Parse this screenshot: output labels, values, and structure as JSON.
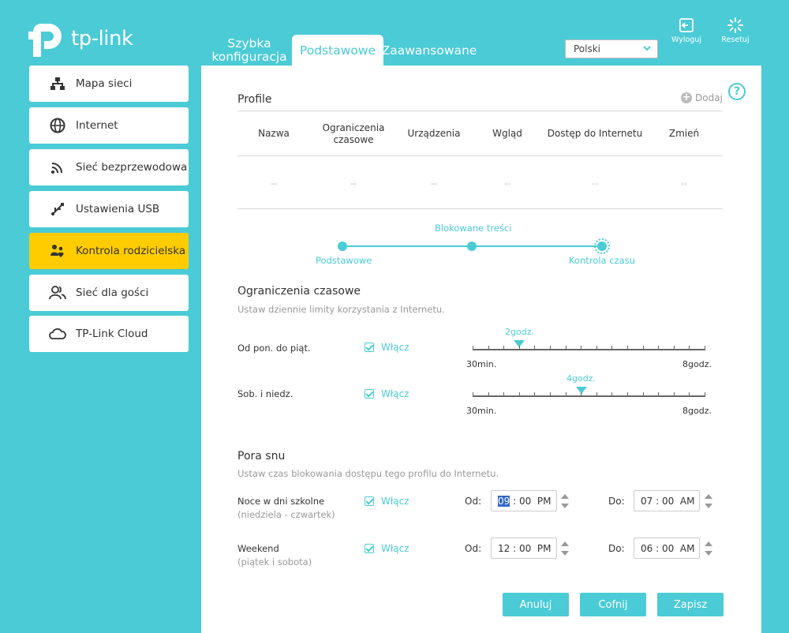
{
  "brand": {
    "name": "tp-link"
  },
  "colors": {
    "accent": "#4acbd6",
    "active_nav": "#ffcc00"
  },
  "tabs": [
    {
      "label": "Szybka konfiguracja"
    },
    {
      "label": "Podstawowe",
      "active": true
    },
    {
      "label": "Zaawansowane"
    }
  ],
  "language": {
    "selected": "Polski"
  },
  "header_buttons": {
    "logout": "Wyloguj",
    "reset": "Resetuj"
  },
  "sidebar": {
    "items": [
      {
        "label": "Mapa sieci",
        "icon": "network-map-icon"
      },
      {
        "label": "Internet",
        "icon": "globe-icon"
      },
      {
        "label": "Sieć bezprzewodowa",
        "icon": "wifi-icon"
      },
      {
        "label": "Ustawienia USB",
        "icon": "usb-icon"
      },
      {
        "label": "Kontrola rodzicielska",
        "icon": "parental-icon",
        "active": true
      },
      {
        "label": "Sieć dla gości",
        "icon": "guests-icon"
      },
      {
        "label": "TP-Link Cloud",
        "icon": "cloud-icon"
      }
    ]
  },
  "profiles": {
    "title": "Profile",
    "add_label": "Dodaj",
    "columns": [
      "Nazwa",
      "Ograniczenia czasowe",
      "Urządzenia",
      "Wgląd",
      "Dostęp do Internetu",
      "Zmień"
    ],
    "row": [
      "--",
      "--",
      "--",
      "--",
      "--",
      "--"
    ]
  },
  "steps": {
    "items": [
      "Podstawowe",
      "Blokowane treści",
      "Kontrola czasu"
    ],
    "current": 3
  },
  "time_limits": {
    "title": "Ograniczenia czasowe",
    "subtitle": "Ustaw dziennie limity korzystania z Internetu.",
    "rows": [
      {
        "label": "Od pon. do piąt.",
        "enable_label": "Włącz",
        "enabled": true,
        "value_label": "2godz.",
        "value_hours": 2
      },
      {
        "label": "Sob. i niedz.",
        "enable_label": "Włącz",
        "enabled": true,
        "value_label": "4godz.",
        "value_hours": 4
      }
    ],
    "min_label": "30min.",
    "max_label": "8godz."
  },
  "bedtime": {
    "title": "Pora snu",
    "subtitle": "Ustaw czas blokowania dostępu tego profilu do Internetu.",
    "from_label": "Od:",
    "to_label": "Do:",
    "rows": [
      {
        "label": "Noce w dni szkolne",
        "sublabel": "(niedziela - czwartek)",
        "enable_label": "Włącz",
        "enabled": true,
        "from": {
          "h": "09",
          "m": "00",
          "ampm": "PM"
        },
        "to": {
          "h": "07",
          "m": "00",
          "ampm": "AM"
        }
      },
      {
        "label": "Weekend",
        "sublabel": "(piątek i sobota)",
        "enable_label": "Włącz",
        "enabled": true,
        "from": {
          "h": "12",
          "m": "00",
          "ampm": "PM"
        },
        "to": {
          "h": "06",
          "m": "00",
          "ampm": "AM"
        }
      }
    ]
  },
  "actions": {
    "cancel": "Anuluj",
    "back": "Cofnij",
    "save": "Zapisz"
  }
}
